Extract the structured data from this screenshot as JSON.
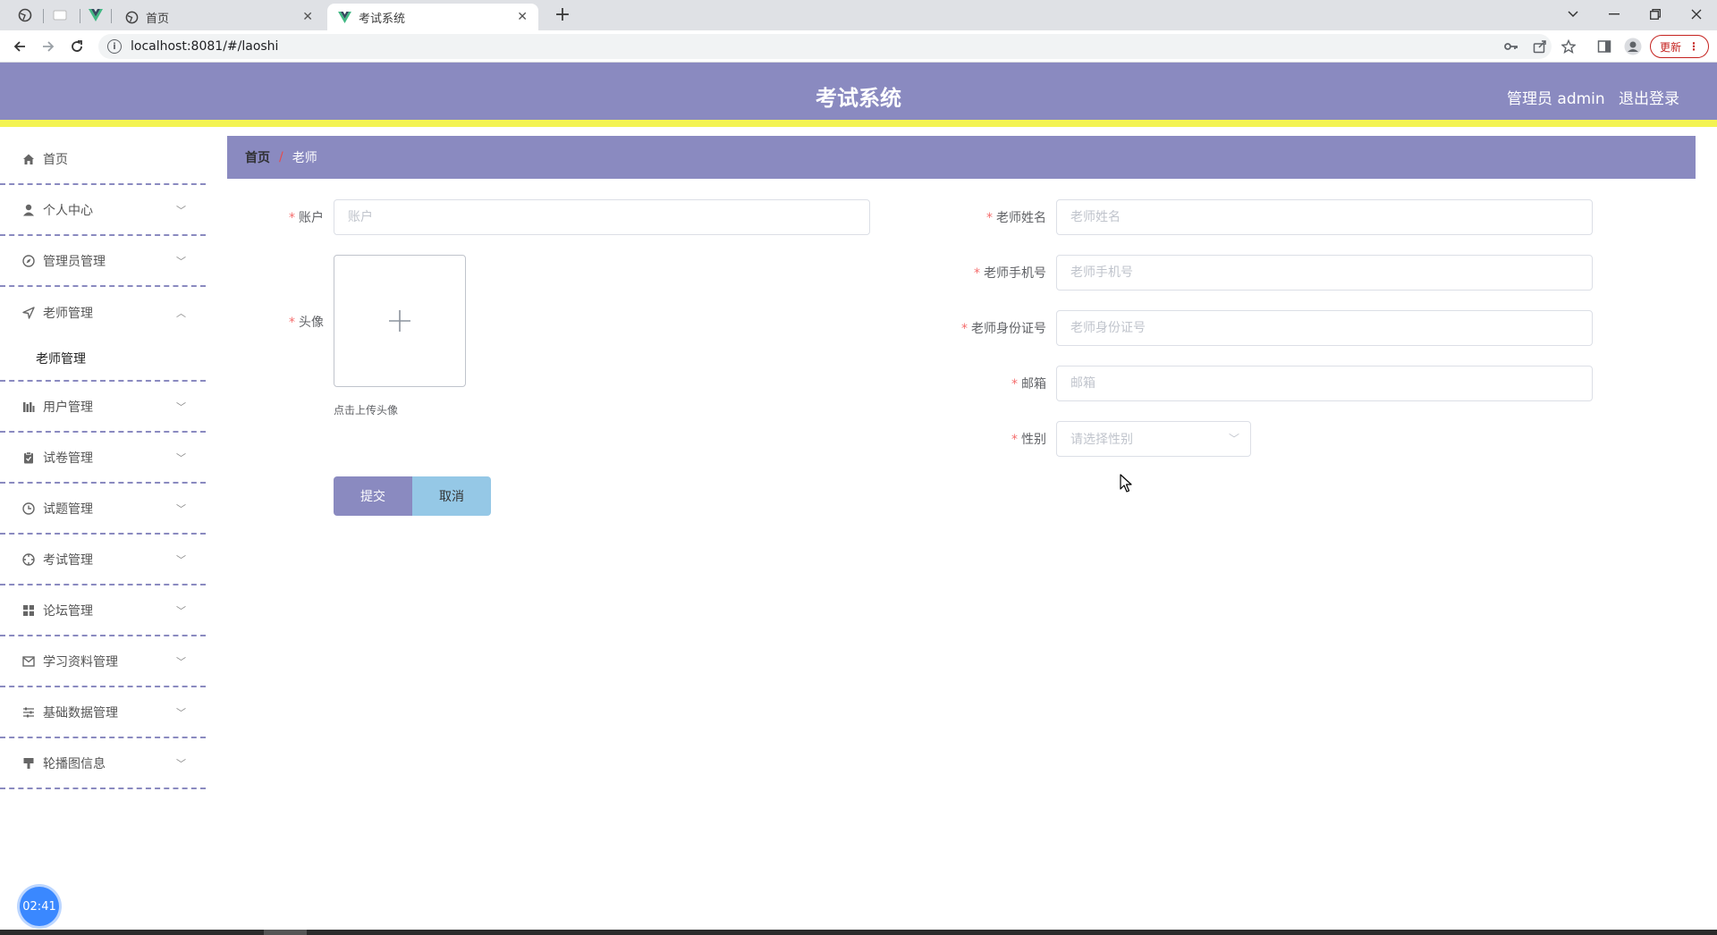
{
  "browser": {
    "tabs": [
      {
        "title": "首页"
      },
      {
        "title": "考试系统"
      }
    ],
    "url": "localhost:8081/#/laoshi",
    "update_label": "更新"
  },
  "header": {
    "title": "考试系统",
    "user": "管理员 admin",
    "logout": "退出登录"
  },
  "sidebar": {
    "items": [
      {
        "label": "首页",
        "icon": "home-icon"
      },
      {
        "label": "个人中心",
        "icon": "user-icon"
      },
      {
        "label": "管理员管理",
        "icon": "compass-icon"
      },
      {
        "label": "老师管理",
        "icon": "navigation-icon"
      },
      {
        "label": "用户管理",
        "icon": "chart-icon"
      },
      {
        "label": "试卷管理",
        "icon": "clipboard-icon"
      },
      {
        "label": "试题管理",
        "icon": "clock-icon"
      },
      {
        "label": "考试管理",
        "icon": "target-icon"
      },
      {
        "label": "论坛管理",
        "icon": "grid-icon"
      },
      {
        "label": "学习资料管理",
        "icon": "mail-icon"
      },
      {
        "label": "基础数据管理",
        "icon": "sliders-icon"
      },
      {
        "label": "轮播图信息",
        "icon": "brush-icon"
      }
    ],
    "submenu": {
      "label": "老师管理"
    },
    "clock": "02:41"
  },
  "breadcrumb": {
    "home": "首页",
    "separator": "/",
    "current": "老师"
  },
  "form": {
    "account": {
      "label": "账户",
      "placeholder": "账户"
    },
    "avatar": {
      "label": "头像",
      "hint": "点击上传头像"
    },
    "name": {
      "label": "老师姓名",
      "placeholder": "老师姓名"
    },
    "phone": {
      "label": "老师手机号",
      "placeholder": "老师手机号"
    },
    "idcard": {
      "label": "老师身份证号",
      "placeholder": "老师身份证号"
    },
    "email": {
      "label": "邮箱",
      "placeholder": "邮箱"
    },
    "gender": {
      "label": "性别",
      "placeholder": "请选择性别"
    },
    "required_mark": "*",
    "submit": "提交",
    "cancel": "取消"
  },
  "colors": {
    "primary": "#8a8ac0",
    "accent_strip": "#f3f352",
    "cancel": "#95c8e6",
    "required": "#f56c6c"
  }
}
